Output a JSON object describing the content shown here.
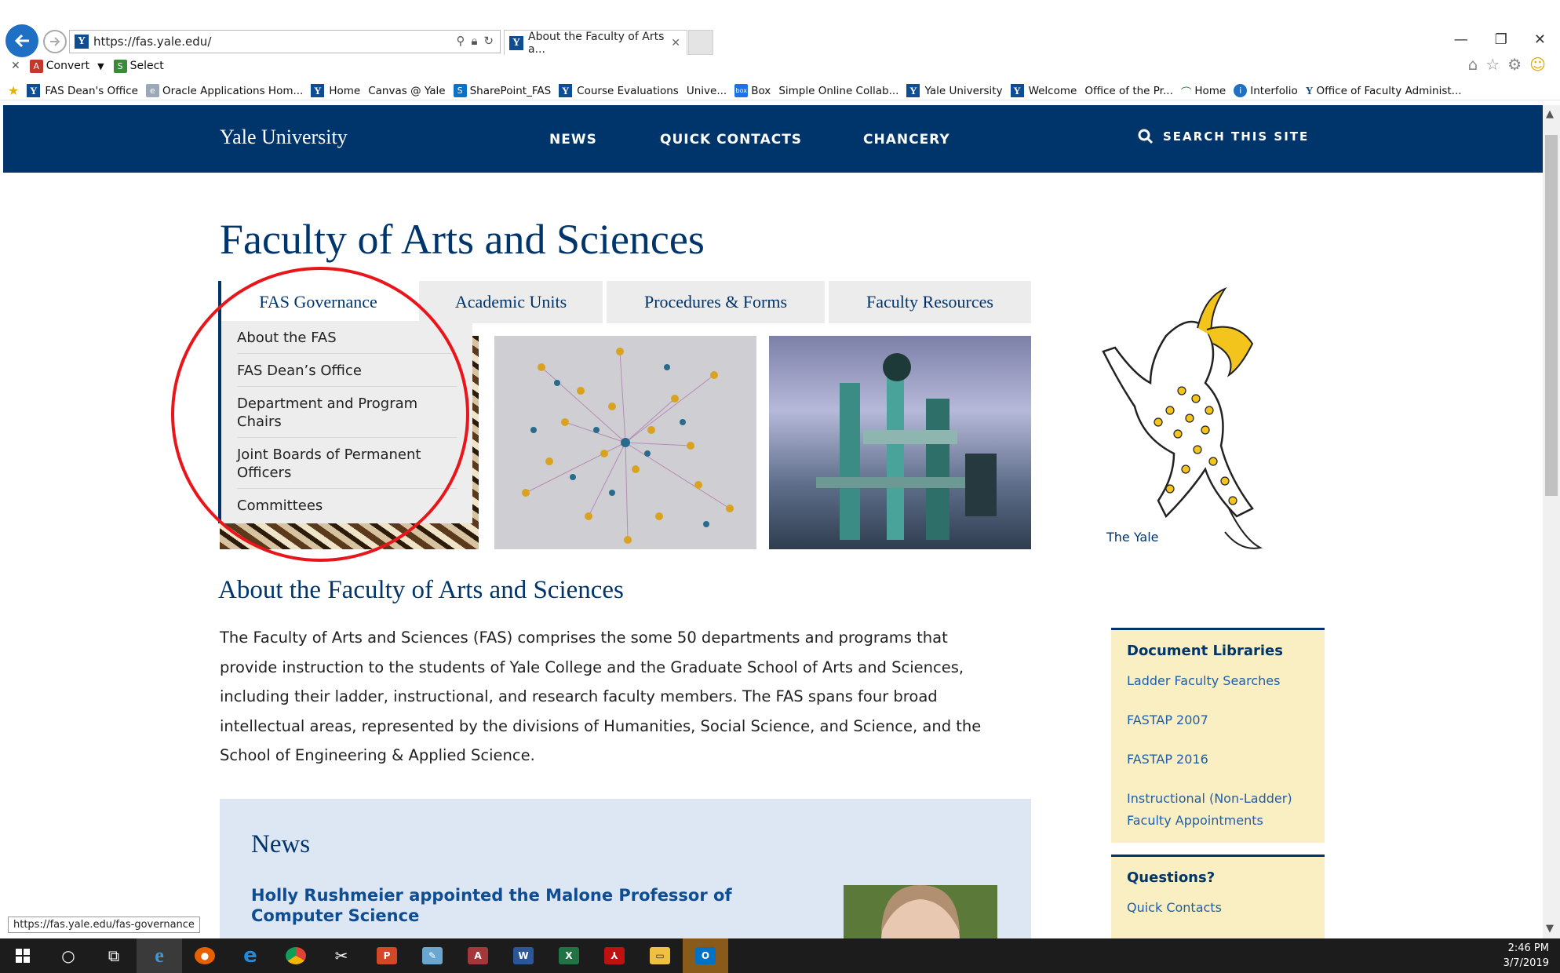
{
  "browser": {
    "address_url": "https://fas.yale.edu/",
    "tab_title": "About the Faculty of Arts a...",
    "toolbar_convert": "Convert",
    "toolbar_select": "Select",
    "favorites": [
      "FAS Dean's Office",
      "Oracle Applications Hom...",
      "Home",
      "Canvas @ Yale",
      "SharePoint_FAS",
      "Course Evaluations",
      "Unive...",
      "Box",
      "Simple Online Collab...",
      "Yale University",
      "Welcome",
      "Office of the Pr...",
      "Home",
      "Interfolio",
      "Office of Faculty Administ..."
    ],
    "status_url": "https://fas.yale.edu/fas-governance"
  },
  "site": {
    "brand": "Yale University",
    "nav": [
      "NEWS",
      "QUICK CONTACTS",
      "CHANCERY"
    ],
    "search_label": "SEARCH THIS SITE",
    "page_title": "Faculty of Arts and Sciences",
    "tabs": [
      "FAS Governance",
      "Academic Units",
      "Procedures & Forms",
      "Faculty Resources"
    ],
    "governance_menu": [
      "About the FAS",
      "FAS Dean’s Office",
      "Department and Program Chairs",
      "Joint Boards of Permanent Officers",
      "Committees"
    ],
    "mascot_caption": "The Yale",
    "about_heading": "About the Faculty of Arts and Sciences",
    "about_text": "The Faculty of Arts and Sciences (FAS) comprises the some 50 departments and programs that provide instruction to the students of Yale College and the Graduate School of Arts and Sciences, including their ladder, instructional, and research faculty members. The FAS spans four broad intellectual areas, represented by the divisions of Humanities, Social Science, and Science, and the School of Engineering & Applied Science.",
    "news_heading": "News",
    "news_item_title": "Holly Rushmeier appointed the Malone Professor of Computer Science",
    "doc_libraries": {
      "heading": "Document Libraries",
      "links": [
        "Ladder Faculty Searches",
        "FASTAP 2007",
        "FASTAP 2016",
        "Instructional (Non-Ladder) Faculty Appointments"
      ]
    },
    "questions": {
      "heading": "Questions?",
      "links": [
        "Quick Contacts"
      ]
    }
  },
  "taskbar": {
    "time": "2:46 PM",
    "date": "3/7/2019"
  },
  "colors": {
    "yale_blue": "#00356b",
    "link_blue": "#1f5ea8",
    "sidebar_yellow": "#f9efc2",
    "news_bg": "#dde6f3",
    "annotation_red": "#e8151b"
  }
}
